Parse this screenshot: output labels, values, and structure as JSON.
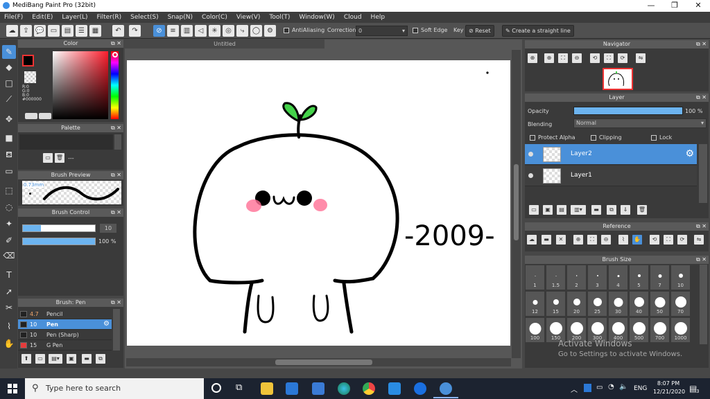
{
  "window": {
    "title": "MediBang Paint Pro (32bit)",
    "controls": [
      "—",
      "❐",
      "✕"
    ]
  },
  "menu": [
    "File(F)",
    "Edit(E)",
    "Layer(L)",
    "Filter(R)",
    "Select(S)",
    "Snap(N)",
    "Color(C)",
    "View(V)",
    "Tool(T)",
    "Window(W)",
    "Cloud",
    "Help"
  ],
  "toolbar": {
    "antialiasing_label": "AntiAliasing",
    "correction_label": "Correction",
    "correction_value": "0",
    "soft_edge_label": "Soft Edge",
    "key_label": "Key",
    "reset_label": "Reset",
    "straight_line_label": "Create a straight line"
  },
  "color_panel": {
    "title": "Color",
    "r": "R:0",
    "g": "G:0",
    "b": "B:0",
    "hex": "#000000"
  },
  "palette_panel": {
    "title": "Palette",
    "value": "---"
  },
  "brush_preview": {
    "title": "Brush Preview",
    "size": "0.73mm"
  },
  "brush_control": {
    "title": "Brush Control",
    "size_value": "10",
    "opacity_value": "100 %",
    "size_fraction": 0.25,
    "opacity_fraction": 1.0
  },
  "brush_list": {
    "title": "Brush: Pen",
    "items": [
      {
        "size": "4.7",
        "name": "Pencil",
        "swatch": "#222222"
      },
      {
        "size": "10",
        "name": "Pen",
        "swatch": "#222222"
      },
      {
        "size": "10",
        "name": "Pen (Sharp)",
        "swatch": "#222222"
      },
      {
        "size": "15",
        "name": "G Pen",
        "swatch": "#e63b3b"
      }
    ]
  },
  "canvas": {
    "tab_title": "Untitled",
    "drawing_text": "-2009-"
  },
  "navigator": {
    "title": "Navigator"
  },
  "layer_panel": {
    "title": "Layer",
    "opacity_label": "Opacity",
    "opacity_value": "100 %",
    "opacity_fraction": 1.0,
    "blending_label": "Blending",
    "blending_value": "Normal",
    "protect_alpha_label": "Protect Alpha",
    "clipping_label": "Clipping",
    "lock_label": "Lock",
    "layers": [
      {
        "name": "Layer2"
      },
      {
        "name": "Layer1"
      }
    ]
  },
  "reference_panel": {
    "title": "Reference"
  },
  "brush_size_panel": {
    "title": "Brush Size",
    "sizes": [
      "1",
      "1.5",
      "2",
      "3",
      "4",
      "5",
      "7",
      "10",
      "12",
      "15",
      "20",
      "25",
      "30",
      "40",
      "50",
      "70",
      "100",
      "150",
      "200",
      "300",
      "400",
      "500",
      "700",
      "1000"
    ]
  },
  "watermark": {
    "line1": "Activate Windows",
    "line2": "Go to Settings to activate Windows."
  },
  "taskbar": {
    "search_placeholder": "Type here to search",
    "language": "ENG",
    "time": "8:07 PM",
    "date": "12/21/2020",
    "notification_count": "3"
  },
  "colors": {
    "accent": "#4a90d9",
    "panel_bg": "#3a3a3a",
    "sprout_green": "#44d24a",
    "blush": "#ff7aa0"
  }
}
